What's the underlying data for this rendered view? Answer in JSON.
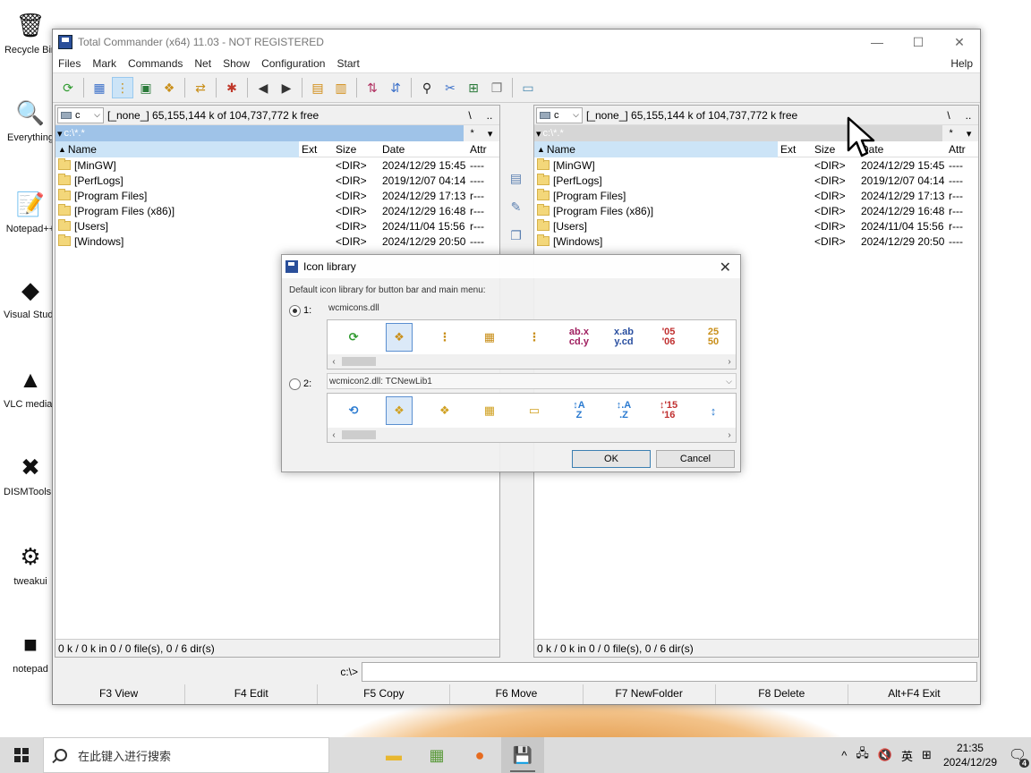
{
  "desktop": {
    "icons": [
      {
        "label": "Recycle Bin",
        "icon": "recycle-bin-icon",
        "glyph": "🗑"
      },
      {
        "label": "Everything",
        "icon": "everything-search-icon",
        "glyph": "🔍"
      },
      {
        "label": "Notepad++",
        "icon": "notepadpp-icon",
        "glyph": "📝"
      },
      {
        "label": "Visual Studio Code",
        "icon": "vscode-icon",
        "glyph": "◆"
      },
      {
        "label": "VLC media player",
        "icon": "vlc-icon",
        "glyph": "▲"
      },
      {
        "label": "DISMTools Preview",
        "icon": "dismtools-icon",
        "glyph": "✖"
      },
      {
        "label": "tweakui",
        "icon": "tweakui-icon",
        "glyph": "⚙"
      },
      {
        "label": "notepad",
        "icon": "notepad-icon",
        "glyph": "■"
      }
    ]
  },
  "window": {
    "title": "Total Commander (x64) 11.03 - NOT REGISTERED",
    "menu": [
      "Files",
      "Mark",
      "Commands",
      "Net",
      "Show",
      "Configuration",
      "Start"
    ],
    "help": "Help",
    "controls": {
      "minimize": "—",
      "maximize": "☐",
      "close": "✕"
    }
  },
  "toolbar": [
    {
      "name": "refresh-icon",
      "glyph": "⟳",
      "color": "#2e9a2e"
    },
    {
      "sep": true
    },
    {
      "name": "brief-view-icon",
      "glyph": "▦",
      "color": "#3a6fc9"
    },
    {
      "name": "tree-view-icon",
      "glyph": "⋮",
      "color": "#c98f1a",
      "active": true
    },
    {
      "name": "thumbnails-icon",
      "glyph": "▣",
      "color": "#2a7a3a"
    },
    {
      "name": "tree-icon",
      "glyph": "❖",
      "color": "#c98f1a"
    },
    {
      "sep": true
    },
    {
      "name": "invert-selection-icon",
      "glyph": "⇄",
      "color": "#c98f1a"
    },
    {
      "sep": true
    },
    {
      "name": "pack-icon",
      "glyph": "✱",
      "color": "#c0392b"
    },
    {
      "sep": true
    },
    {
      "name": "back-icon",
      "glyph": "◀",
      "color": "#333333"
    },
    {
      "name": "forward-icon",
      "glyph": "▶",
      "color": "#333333"
    },
    {
      "sep": true
    },
    {
      "name": "zip-pack-icon",
      "glyph": "▤",
      "color": "#d08a10"
    },
    {
      "name": "zip-unpack-icon",
      "glyph": "▥",
      "color": "#d08a10"
    },
    {
      "sep": true
    },
    {
      "name": "ftp-connect-icon",
      "glyph": "⇅",
      "color": "#b03060"
    },
    {
      "name": "url-connect-icon",
      "glyph": "⇵",
      "color": "#3a6fc9"
    },
    {
      "sep": true
    },
    {
      "name": "find-files-icon",
      "glyph": "⚲",
      "color": "#222222"
    },
    {
      "name": "multi-rename-icon",
      "glyph": "✂",
      "color": "#3a6fc9"
    },
    {
      "name": "sync-dirs-icon",
      "glyph": "⊞",
      "color": "#2a7a3a"
    },
    {
      "name": "copy-names-icon",
      "glyph": "❐",
      "color": "#777777"
    },
    {
      "sep": true
    },
    {
      "name": "notepad-icon",
      "glyph": "▭",
      "color": "#4a8ab0"
    }
  ],
  "left_panel": {
    "drive": "c",
    "drive_info": "[_none_]  65,155,144 k of 104,737,772 k free",
    "dir_tools": [
      "\\",
      ".."
    ],
    "path": "c:\\*.*",
    "path_tools": [
      "*",
      "▾"
    ],
    "columns": {
      "name": "Name",
      "ext": "Ext",
      "size": "Size",
      "date": "Date",
      "attr": "Attr"
    },
    "files": [
      {
        "name": "[MinGW]",
        "size": "<DIR>",
        "date": "2024/12/29 15:45",
        "attr": "----"
      },
      {
        "name": "[PerfLogs]",
        "size": "<DIR>",
        "date": "2019/12/07 04:14",
        "attr": "----"
      },
      {
        "name": "[Program Files]",
        "size": "<DIR>",
        "date": "2024/12/29 17:13",
        "attr": "r---"
      },
      {
        "name": "[Program Files (x86)]",
        "size": "<DIR>",
        "date": "2024/12/29 16:48",
        "attr": "r---"
      },
      {
        "name": "[Users]",
        "size": "<DIR>",
        "date": "2024/11/04 15:56",
        "attr": "r---"
      },
      {
        "name": "[Windows]",
        "size": "<DIR>",
        "date": "2024/12/29 20:50",
        "attr": "----"
      }
    ],
    "status": "0 k / 0 k in 0 / 0 file(s), 0 / 6 dir(s)"
  },
  "right_panel": {
    "drive": "c",
    "drive_info": "[_none_]  65,155,144 k of 104,737,772 k free",
    "dir_tools": [
      "\\",
      ".."
    ],
    "path": "c:\\*.*",
    "path_tools": [
      "*",
      "▾"
    ],
    "columns": {
      "name": "Name",
      "ext": "Ext",
      "size": "Size",
      "date": "Date",
      "attr": "Attr"
    },
    "files": [
      {
        "name": "[MinGW]",
        "size": "<DIR>",
        "date": "2024/12/29 15:45",
        "attr": "----"
      },
      {
        "name": "[PerfLogs]",
        "size": "<DIR>",
        "date": "2019/12/07 04:14",
        "attr": "----"
      },
      {
        "name": "[Program Files]",
        "size": "<DIR>",
        "date": "2024/12/29 17:13",
        "attr": "r---"
      },
      {
        "name": "[Program Files (x86)]",
        "size": "<DIR>",
        "date": "2024/12/29 16:48",
        "attr": "r---"
      },
      {
        "name": "[Users]",
        "size": "<DIR>",
        "date": "2024/11/04 15:56",
        "attr": "r---"
      },
      {
        "name": "[Windows]",
        "size": "<DIR>",
        "date": "2024/12/29 20:50",
        "attr": "----"
      }
    ],
    "status": "0 k / 0 k in 0 / 0 file(s), 0 / 6 dir(s)"
  },
  "vertical_buttons": [
    {
      "name": "view-file-icon",
      "glyph": "▤"
    },
    {
      "name": "edit-file-icon",
      "glyph": "✎"
    },
    {
      "name": "copy-file-icon",
      "glyph": "❐"
    }
  ],
  "command_line": {
    "label": "c:\\>",
    "value": ""
  },
  "fkeys": [
    "F3 View",
    "F4 Edit",
    "F5 Copy",
    "F6 Move",
    "F7 NewFolder",
    "F8 Delete",
    "Alt+F4 Exit"
  ],
  "dialog": {
    "title": "Icon library",
    "description": "Default icon library for button bar and main menu:",
    "option1": {
      "label": "1:",
      "library": "wcmicons.dll",
      "selected": true
    },
    "option2": {
      "label": "2:",
      "library": "wcmicon2.dll: TCNewLib1",
      "selected": false
    },
    "icons1": [
      {
        "name": "refresh-icon",
        "glyph": "⟳",
        "color": "#2e9a2e"
      },
      {
        "name": "tree-view-icon",
        "glyph": "❖",
        "color": "#c98f1a",
        "selected": true
      },
      {
        "name": "tree-icon",
        "glyph": "⋮",
        "color": "#c98f1a"
      },
      {
        "name": "brief-view-icon",
        "glyph": "▦",
        "color": "#c98f1a"
      },
      {
        "name": "list-view-icon",
        "glyph": "⋮",
        "color": "#c98f1a"
      },
      {
        "name": "sort-name-icon",
        "text": [
          "ab.x",
          "cd.y"
        ],
        "color": "#a02060"
      },
      {
        "name": "sort-ext-icon",
        "text": [
          "x.ab",
          "y.cd"
        ],
        "color": "#2a4fa0"
      },
      {
        "name": "sort-date-icon",
        "text": [
          "'05",
          "'06"
        ],
        "color": "#c03030"
      },
      {
        "name": "sort-size-icon",
        "text": [
          "25",
          "50"
        ],
        "color": "#c98f1a"
      }
    ],
    "icons2": [
      {
        "name": "refresh-icon",
        "glyph": "⟲",
        "color": "#2a7ad0"
      },
      {
        "name": "tree-view-icon",
        "glyph": "❖",
        "color": "#d0a020",
        "selected": true
      },
      {
        "name": "tree-icon",
        "glyph": "❖",
        "color": "#d0a020"
      },
      {
        "name": "brief-view-icon",
        "glyph": "▦",
        "color": "#d0a020"
      },
      {
        "name": "list-view-icon",
        "glyph": "▭",
        "color": "#d0a020"
      },
      {
        "name": "sort-name-icon",
        "text": [
          "↕A",
          " Z"
        ],
        "color": "#2a7ad0"
      },
      {
        "name": "sort-ext-icon",
        "text": [
          "↕.A",
          " .Z"
        ],
        "color": "#2a7ad0"
      },
      {
        "name": "sort-date-icon",
        "text": [
          "↕'15",
          " '16"
        ],
        "color": "#c03030"
      },
      {
        "name": "sort-size-icon",
        "glyph": "↕",
        "color": "#2a7ad0"
      }
    ],
    "ok": "OK",
    "cancel": "Cancel"
  },
  "taskbar": {
    "search_placeholder": "在此键入进行搜索",
    "apps": [
      {
        "name": "file-explorer-icon",
        "glyph": "▬",
        "color": "#e8b730",
        "running": false
      },
      {
        "name": "notepadpp-taskbar-icon",
        "glyph": "▦",
        "color": "#5a9a3a",
        "running": false
      },
      {
        "name": "firefox-icon",
        "glyph": "●",
        "color": "#e66b1f",
        "running": false
      },
      {
        "name": "total-commander-taskbar-icon",
        "glyph": "💾",
        "color": "#2a4f9a",
        "running": true,
        "active": true
      }
    ],
    "tray": [
      "^",
      "🖧",
      "🔇",
      "英",
      "⊞"
    ],
    "time": "21:35",
    "date": "2024/12/29",
    "notifications": "4"
  }
}
